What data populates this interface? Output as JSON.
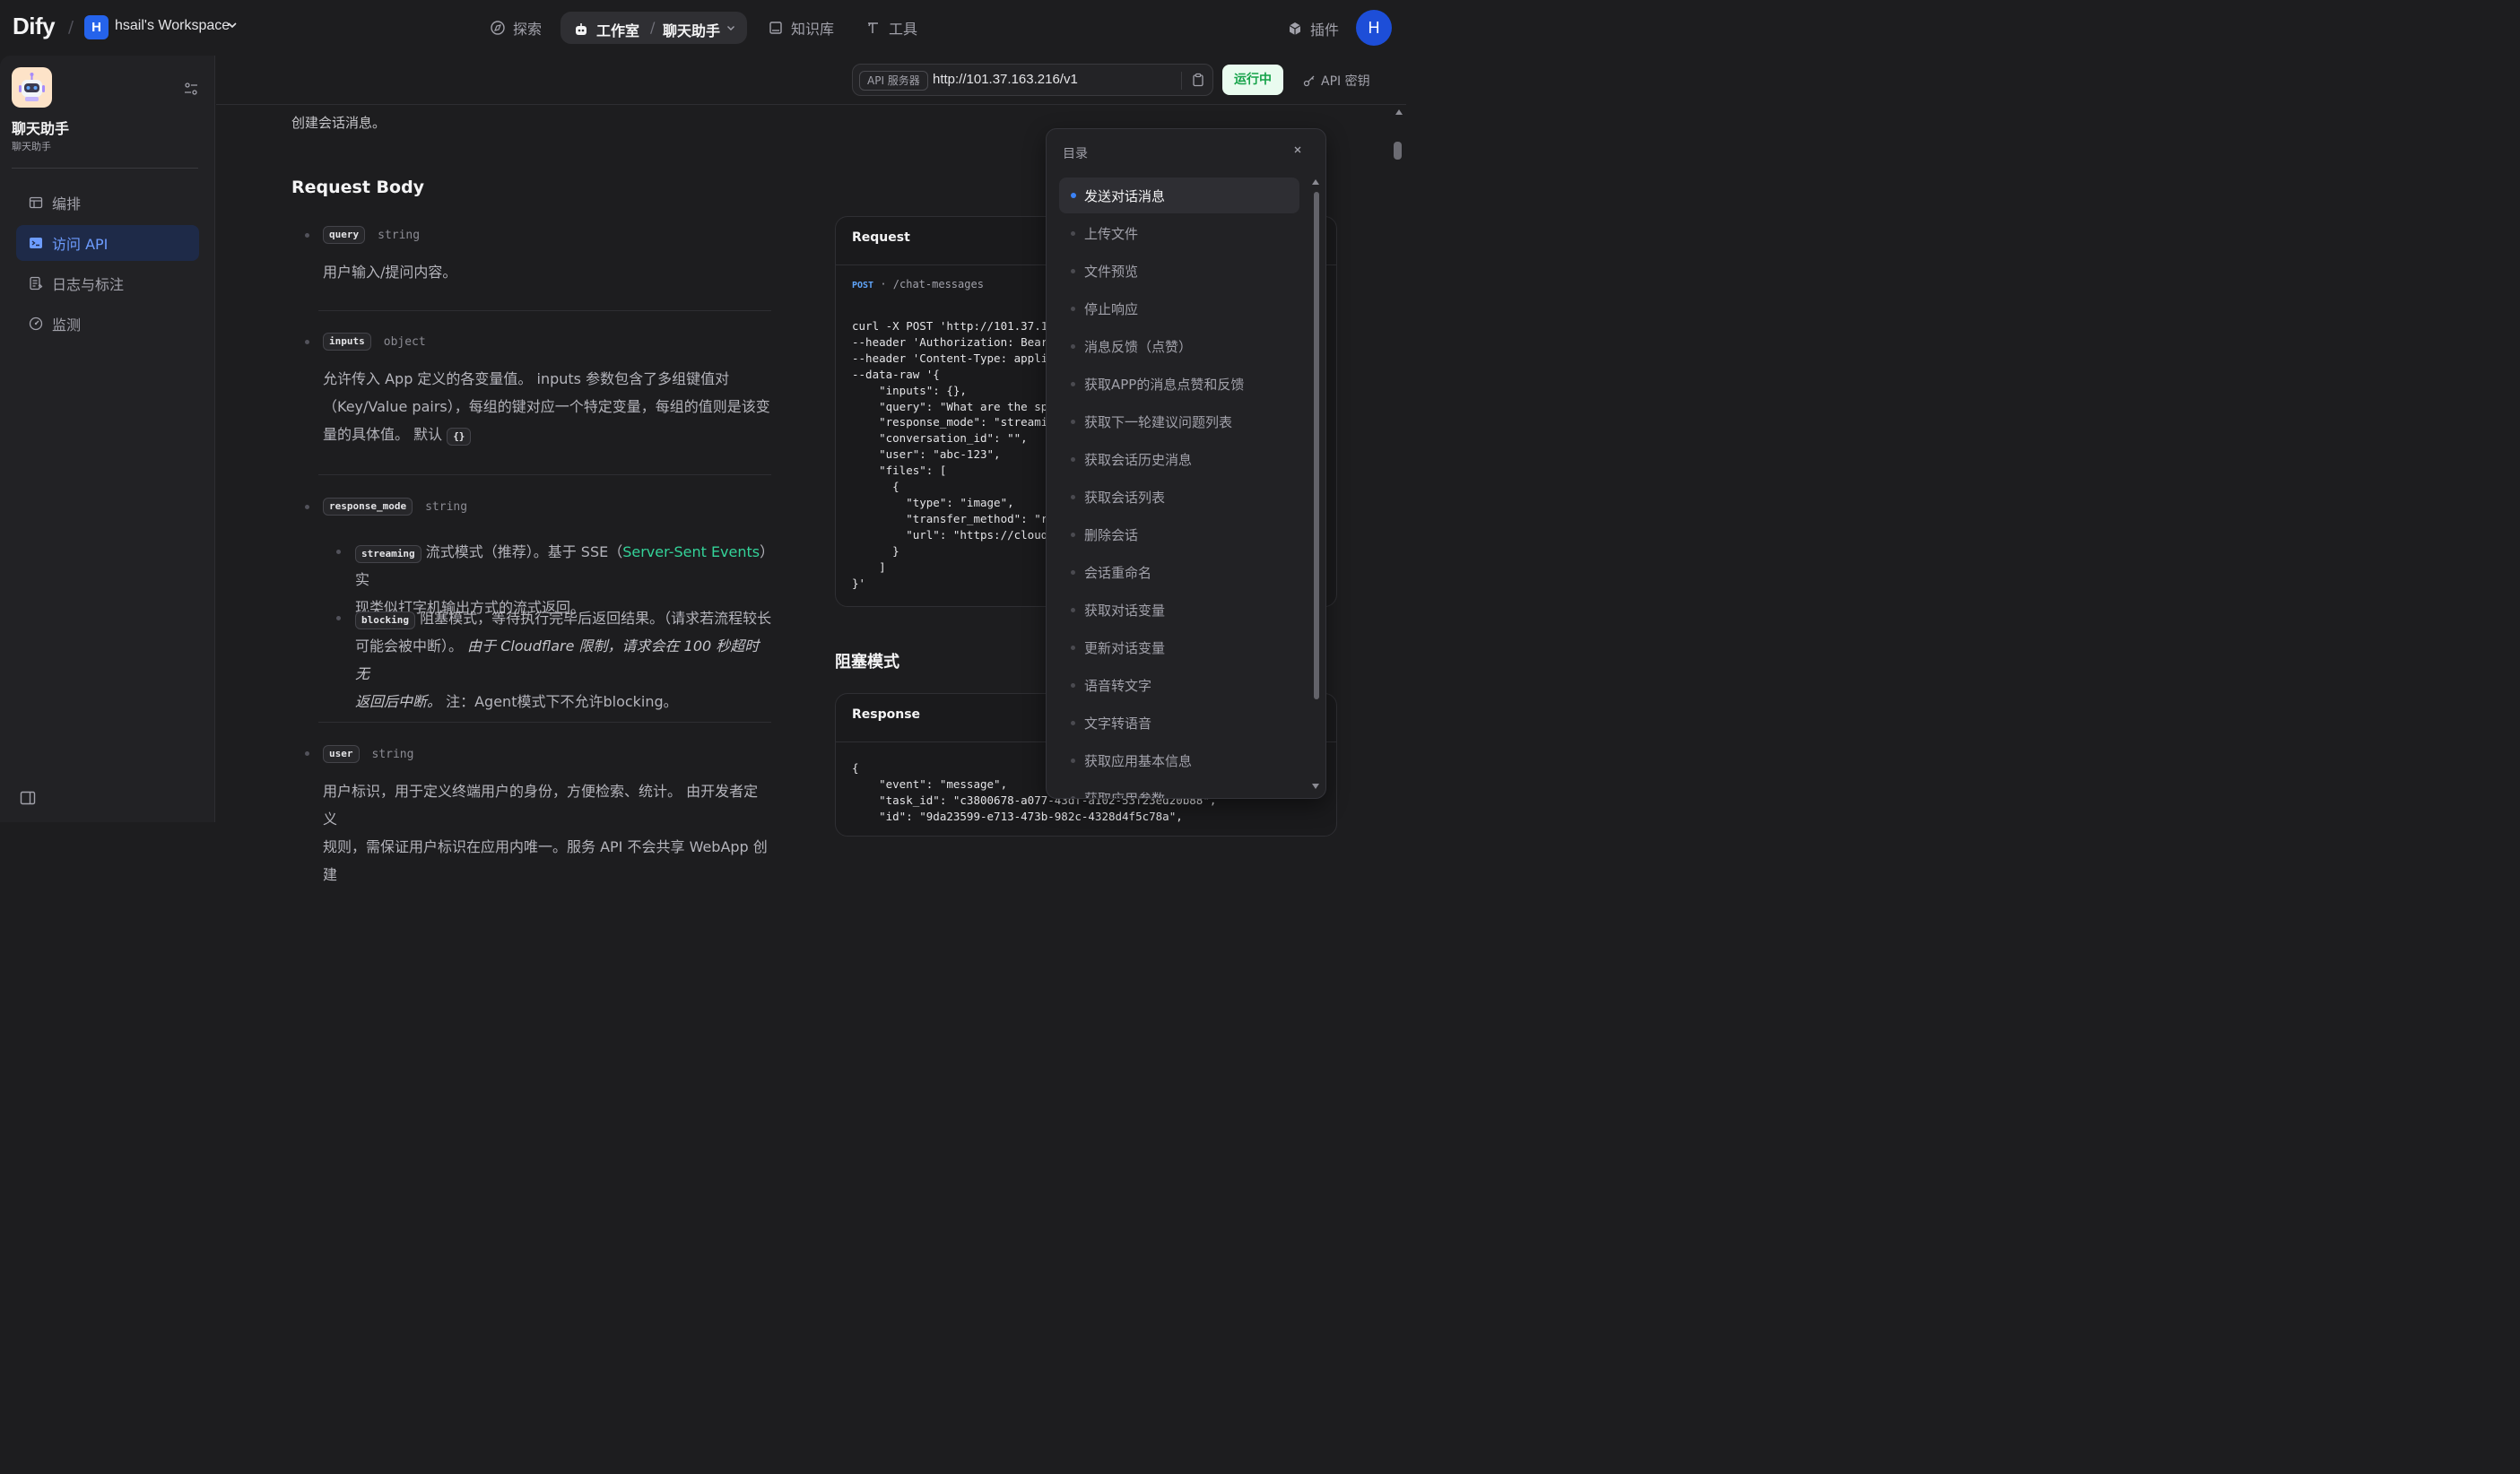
{
  "topbar": {
    "logo": "Dify",
    "workspace_initial": "H",
    "workspace_name": "hsail's Workspace",
    "nav": [
      {
        "label": "探索",
        "icon": "compass-icon"
      },
      {
        "label": "工作室",
        "icon": "robot-icon"
      },
      {
        "label": "知识库",
        "icon": "book-icon"
      },
      {
        "label": "工具",
        "icon": "hammer-icon"
      }
    ],
    "studio_app": "聊天助手",
    "plugins_label": "插件",
    "user_initial": "H"
  },
  "sidebar": {
    "app_name": "聊天助手",
    "app_subtitle": "聊天助手",
    "items": [
      {
        "label": "编排",
        "icon": "layout-icon"
      },
      {
        "label": "访问 API",
        "icon": "terminal-icon"
      },
      {
        "label": "日志与标注",
        "icon": "log-icon"
      },
      {
        "label": "监测",
        "icon": "gauge-icon"
      }
    ]
  },
  "header": {
    "api_server_tag": "API 服务器",
    "api_url": "http://101.37.163.216/v1",
    "status": "运行中",
    "api_key_label": "API 密钥"
  },
  "doc": {
    "intro": "创建会话消息。",
    "request_body_title": "Request Body",
    "params": [
      {
        "name": "query",
        "type": "string",
        "desc": "用户输入/提问内容。"
      },
      {
        "name": "inputs",
        "type": "object",
        "desc_lines": [
          "允许传入 App 定义的各变量值。 inputs 参数包含了多组键值对",
          "（Key/Value pairs），每组的键对应一个特定变量，每组的值则是该变",
          "量的具体值。 默认"
        ],
        "default": "{}"
      },
      {
        "name": "response_mode",
        "type": "string"
      },
      {
        "name": "user",
        "type": "string",
        "desc_lines": [
          "用户标识，用于定义终端用户的身份，方便检索、统计。 由开发者定义",
          "规则，需保证用户标识在应用内唯一。服务 API 不会共享 WebApp 创建"
        ]
      }
    ],
    "streaming": {
      "tag": "streaming",
      "text_a": "流式模式（推荐）。基于 SSE（",
      "link": "Server-Sent Events",
      "text_b": "）实",
      "text_c": "现类似打字机输出方式的流式返回。"
    },
    "blocking": {
      "tag": "blocking",
      "text_a": "阻塞模式，等待执行完毕后返回结果。（请求若流程较长",
      "text_b": "可能会被中断）。",
      "italic_a": "由于 Cloudflare 限制，请求会在 100 秒超时无",
      "italic_b": "返回后中断。",
      "text_c": " 注：Agent模式下不允许blocking。"
    },
    "request_card": {
      "title": "Request",
      "method": "POST",
      "path": "/chat-messages",
      "code": "curl -X POST 'http://101.37.163.216/v1/chat-messages' \\\n--header 'Authorization: Bearer {api_key}' \\\n--header 'Content-Type: application/json' \\\n--data-raw '{\n    \"inputs\": {},\n    \"query\": \"What are the specs of the iPhone 13 Pro Max?\",\n    \"response_mode\": \"streaming\",\n    \"conversation_id\": \"\",\n    \"user\": \"abc-123\",\n    \"files\": [\n      {\n        \"type\": \"image\",\n        \"transfer_method\": \"remote_url\",\n        \"url\": \"https://cloud.dify.ai/logo/logo-site.png\"\n      }\n    ]\n}'"
    },
    "blocking_title": "阻塞模式",
    "response_card": {
      "title": "Response",
      "code": "{\n    \"event\": \"message\",\n    \"task_id\": \"c3800678-a077-43df-a102-53f23ed20b88\",\n    \"id\": \"9da23599-e713-473b-982c-4328d4f5c78a\","
    }
  },
  "toc": {
    "title": "目录",
    "items": [
      "发送对话消息",
      "上传文件",
      "文件预览",
      "停止响应",
      "消息反馈（点赞）",
      "获取APP的消息点赞和反馈",
      "获取下一轮建议问题列表",
      "获取会话历史消息",
      "获取会话列表",
      "删除会话",
      "会话重命名",
      "获取对话变量",
      "更新对话变量",
      "语音转文字",
      "文字转语音",
      "获取应用基本信息",
      "获取应用参数"
    ]
  }
}
